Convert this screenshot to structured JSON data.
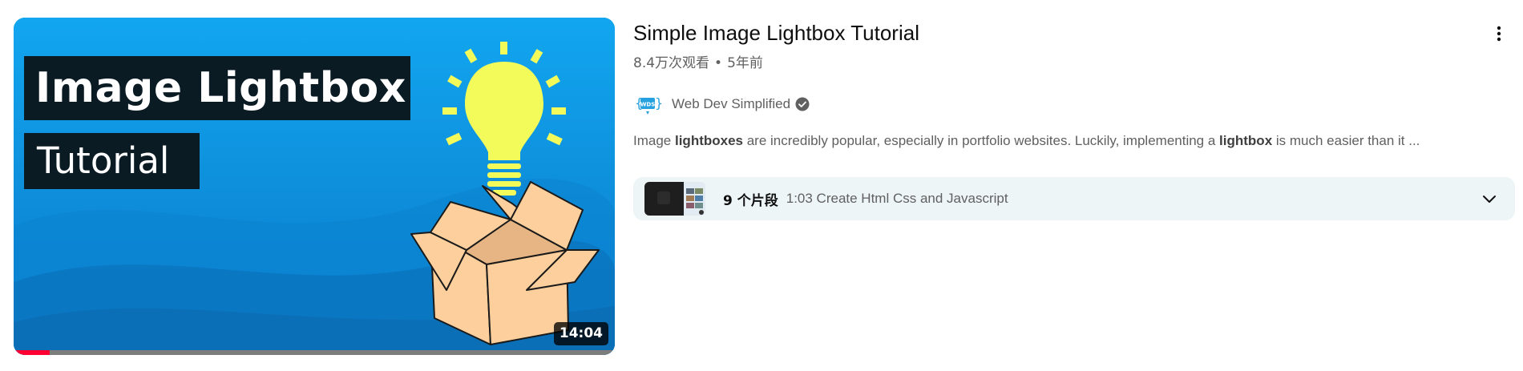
{
  "video": {
    "thumbnail_text_line1": "Image Lightbox",
    "thumbnail_text_line2": "Tutorial",
    "duration": "14:04",
    "progress_fraction": 0.06,
    "title": "Simple Image Lightbox Tutorial",
    "views": "8.4万次观看",
    "separator": "•",
    "age": "5年前",
    "more_icon": "more-vert-icon"
  },
  "channel": {
    "name": "Web Dev Simplified",
    "avatar_text": "WDS",
    "verified_icon": "verified-check-icon"
  },
  "description": {
    "p1": "Image ",
    "b1": "lightboxes",
    "p2": " are incredibly popular, especially in portfolio websites. Luckily, implementing a ",
    "b2": "lightbox",
    "p3": " is much easier than it ..."
  },
  "chapters": {
    "count_label": "9 个片段",
    "current_chapter": "1:03 Create Html Css and Javascript",
    "expand_icon": "chevron-down-icon"
  },
  "colors": {
    "thumb_bg": "#0a8ee0",
    "bulb": "#f2fb5a",
    "box": "#fccf9c",
    "progress": "#ff0033",
    "chapters_bg": "#eef5f7"
  }
}
